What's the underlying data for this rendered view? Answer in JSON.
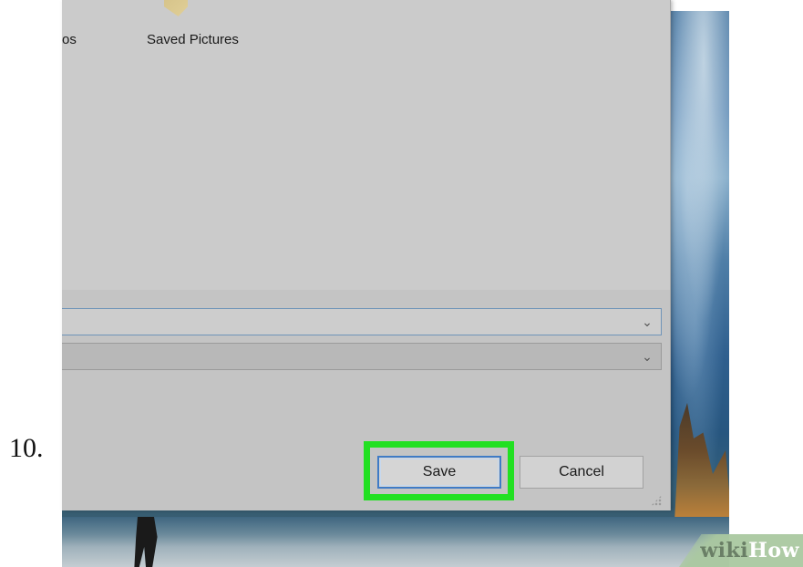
{
  "step": {
    "number": "10."
  },
  "dialog": {
    "folders": [
      {
        "label": "os"
      },
      {
        "label": "Saved Pictures"
      }
    ],
    "file_name_combo": {
      "value": "",
      "chevron": "⌄"
    },
    "file_type_combo": {
      "value": "",
      "chevron": "⌄"
    },
    "buttons": {
      "save_label": "Save",
      "cancel_label": "Cancel"
    }
  },
  "watermark": {
    "part1": "wiki",
    "part2": "How"
  },
  "colors": {
    "highlight": "#22e022",
    "save_focus_border": "#3f7bc6",
    "dialog_bg": "#c8c8c8"
  },
  "icons": {
    "dropdown": "chevron-down-icon",
    "resize": "resize-grip-icon"
  }
}
